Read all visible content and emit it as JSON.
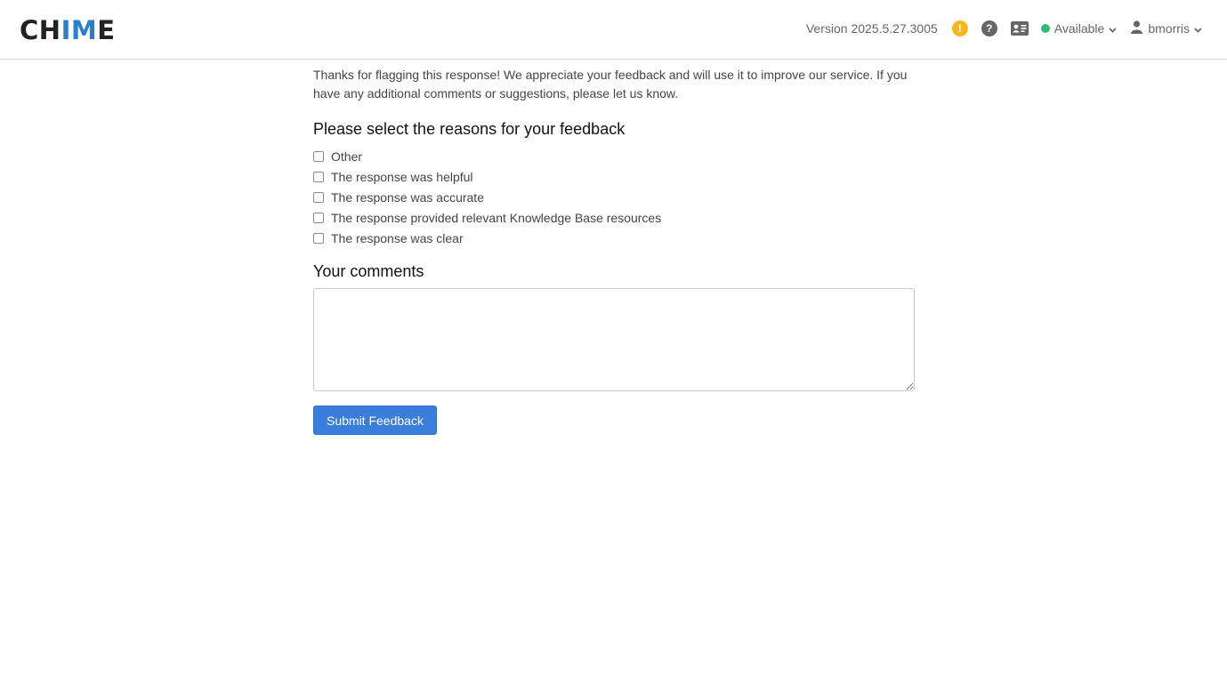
{
  "header": {
    "logo_part1": "CH",
    "logo_part2": "IM",
    "logo_part3": "E",
    "version": "Version 2025.5.27.3005",
    "alert_glyph": "!",
    "help_glyph": "?",
    "status_label": "Available",
    "username": "bmorris"
  },
  "feedback": {
    "intro": "Thanks for flagging this response! We appreciate your feedback and will use it to improve our service. If you have any additional comments or suggestions, please let us know.",
    "reasons_heading": "Please select the reasons for your feedback",
    "reasons": [
      {
        "label": "Other",
        "checked": false
      },
      {
        "label": "The response was helpful",
        "checked": false
      },
      {
        "label": "The response was accurate",
        "checked": false
      },
      {
        "label": "The response provided relevant Knowledge Base resources",
        "checked": false
      },
      {
        "label": "The response was clear",
        "checked": false
      }
    ],
    "comments_heading": "Your comments",
    "comments_value": "",
    "submit_label": "Submit Feedback"
  },
  "colors": {
    "accent_blue": "#3a7ddb",
    "logo_blue": "#2b7fd1",
    "status_green": "#2bbb7c",
    "alert_yellow": "#f4b71c"
  },
  "icons": [
    "alert-icon",
    "help-icon",
    "contact-card-icon",
    "status-dot-icon",
    "chevron-down-icon",
    "user-icon"
  ]
}
